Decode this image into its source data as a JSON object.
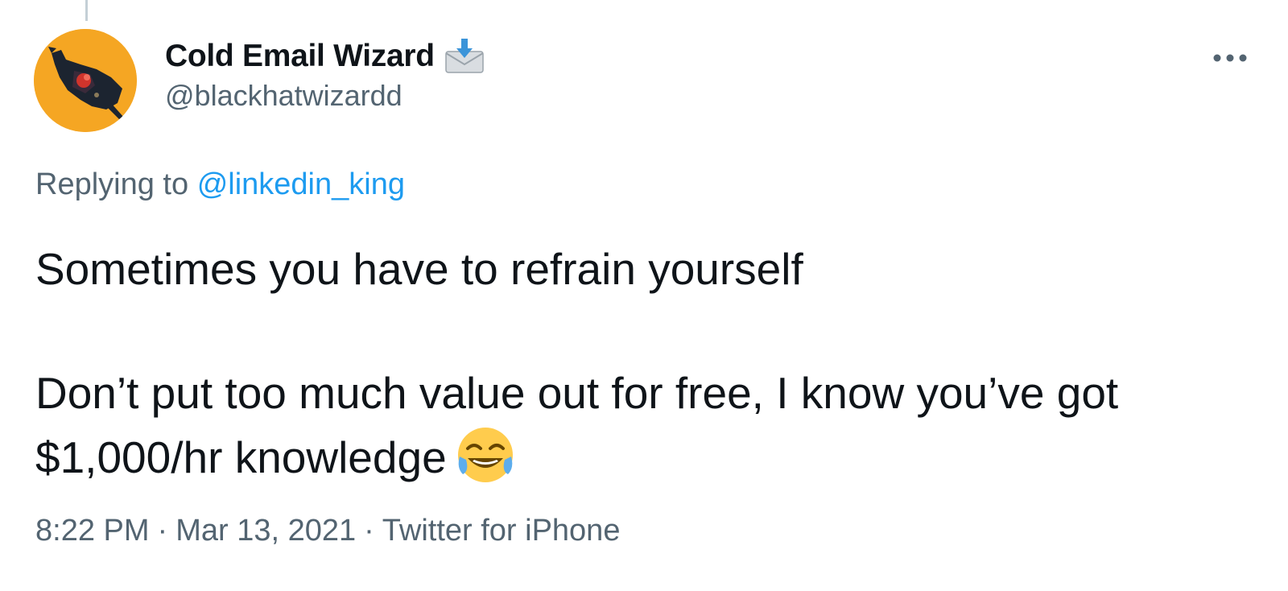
{
  "tweet": {
    "author": {
      "display_name": "Cold Email Wizard",
      "name_emoji": "incoming-envelope-emoji",
      "handle": "@blackhatwizardd",
      "avatar": "wizard-avatar"
    },
    "more_icon": "more-dots-icon",
    "replying_prefix": "Replying to",
    "replying_to": "@linkedin_king",
    "text_line_1": "Sometimes you have to refrain yourself",
    "text_line_2": "Don’t put too much value out for free, I know you’ve got",
    "text_line_3": "$1,000/hr knowledge",
    "text_emoji": "face-with-tears-of-joy-emoji",
    "time": "8:22 PM",
    "date": "Mar 13, 2021",
    "source": "Twitter for iPhone",
    "separator": "·"
  },
  "colors": {
    "text_primary": "#0f1419",
    "text_secondary": "#536471",
    "link": "#1d9bf0",
    "avatar_bg": "#f5a623"
  }
}
